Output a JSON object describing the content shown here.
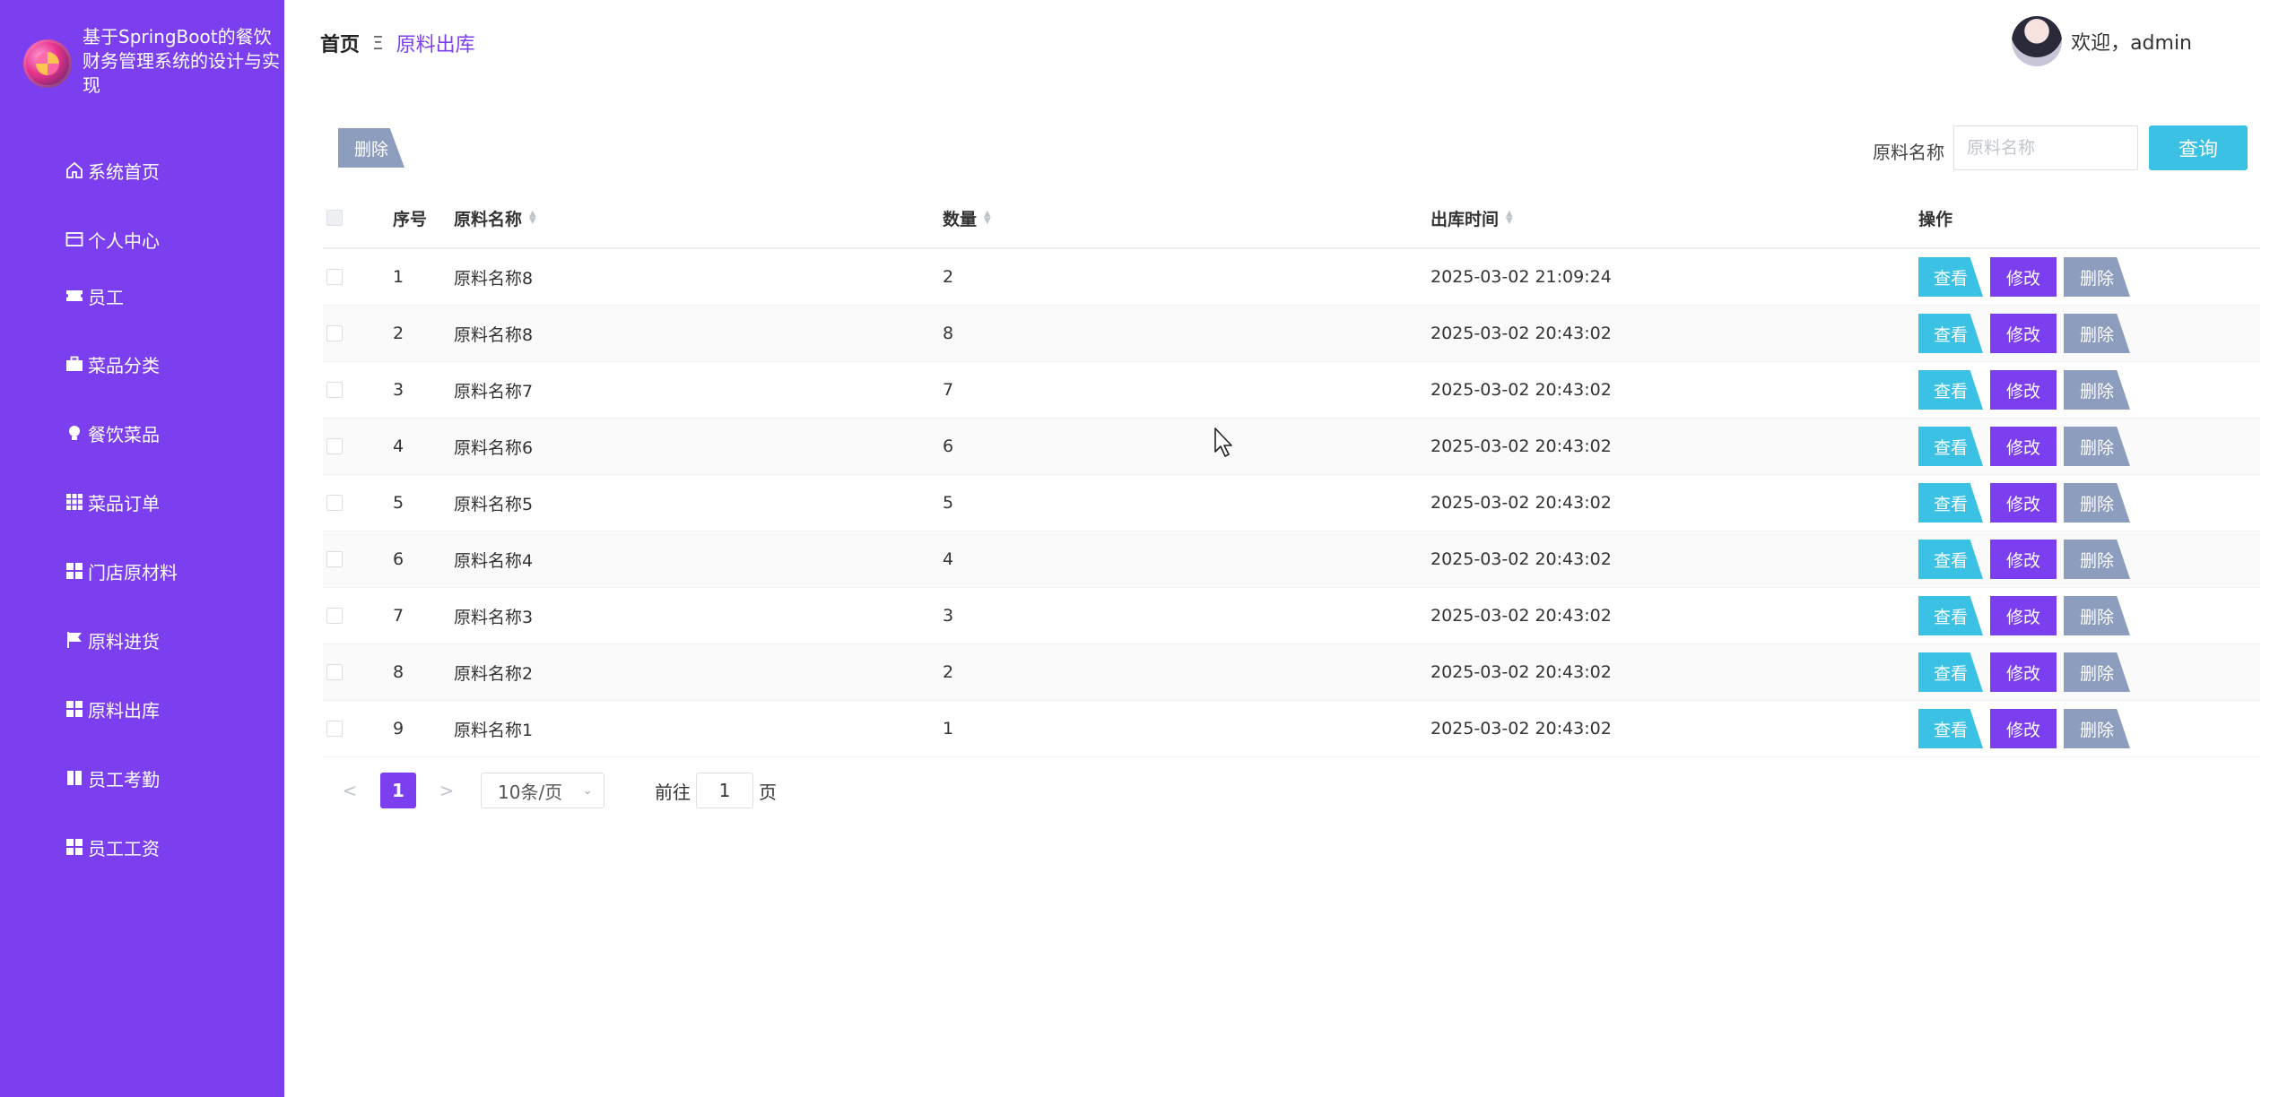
{
  "app": {
    "title": "基于SpringBoot的餐饮财务管理系统的设计与实现"
  },
  "sidebar": {
    "items": [
      {
        "label": "系统首页",
        "icon": "home-icon"
      },
      {
        "label": "个人中心",
        "icon": "card-icon"
      },
      {
        "label": "员工",
        "icon": "ticket-icon"
      },
      {
        "label": "菜品分类",
        "icon": "briefcase-icon"
      },
      {
        "label": "餐饮菜品",
        "icon": "bulb-icon"
      },
      {
        "label": "菜品订单",
        "icon": "grid9-icon"
      },
      {
        "label": "门店原材料",
        "icon": "grid4-icon"
      },
      {
        "label": "原料进货",
        "icon": "flag-icon"
      },
      {
        "label": "原料出库",
        "icon": "grid4-icon"
      },
      {
        "label": "员工考勤",
        "icon": "book-icon"
      },
      {
        "label": "员工工资",
        "icon": "grid4-icon"
      }
    ]
  },
  "header": {
    "breadcrumb": {
      "home": "首页",
      "separator": "Ξ",
      "current": "原料出库"
    },
    "welcome": "欢迎，admin"
  },
  "toolbar": {
    "bulk_delete_label": "删除",
    "search_label": "原料名称",
    "search_placeholder": "原料名称",
    "search_value": "",
    "query_label": "查询"
  },
  "table": {
    "columns": {
      "index": "序号",
      "name": "原料名称",
      "quantity": "数量",
      "time": "出库时间",
      "actions": "操作"
    },
    "actions": {
      "view": "查看",
      "edit": "修改",
      "delete": "删除"
    },
    "rows": [
      {
        "index": "1",
        "name": "原料名称8",
        "quantity": "2",
        "time": "2025-03-02 21:09:24"
      },
      {
        "index": "2",
        "name": "原料名称8",
        "quantity": "8",
        "time": "2025-03-02 20:43:02"
      },
      {
        "index": "3",
        "name": "原料名称7",
        "quantity": "7",
        "time": "2025-03-02 20:43:02"
      },
      {
        "index": "4",
        "name": "原料名称6",
        "quantity": "6",
        "time": "2025-03-02 20:43:02"
      },
      {
        "index": "5",
        "name": "原料名称5",
        "quantity": "5",
        "time": "2025-03-02 20:43:02"
      },
      {
        "index": "6",
        "name": "原料名称4",
        "quantity": "4",
        "time": "2025-03-02 20:43:02"
      },
      {
        "index": "7",
        "name": "原料名称3",
        "quantity": "3",
        "time": "2025-03-02 20:43:02"
      },
      {
        "index": "8",
        "name": "原料名称2",
        "quantity": "2",
        "time": "2025-03-02 20:43:02"
      },
      {
        "index": "9",
        "name": "原料名称1",
        "quantity": "1",
        "time": "2025-03-02 20:43:02"
      }
    ]
  },
  "pagination": {
    "prev": "<",
    "current_page": "1",
    "next": ">",
    "page_size": "10条/页",
    "goto_prefix": "前往",
    "goto_value": "1",
    "goto_suffix": "页"
  },
  "colors": {
    "primary": "#7b3ff0",
    "info": "#3bc1e3",
    "muted": "#8c9dbd"
  }
}
